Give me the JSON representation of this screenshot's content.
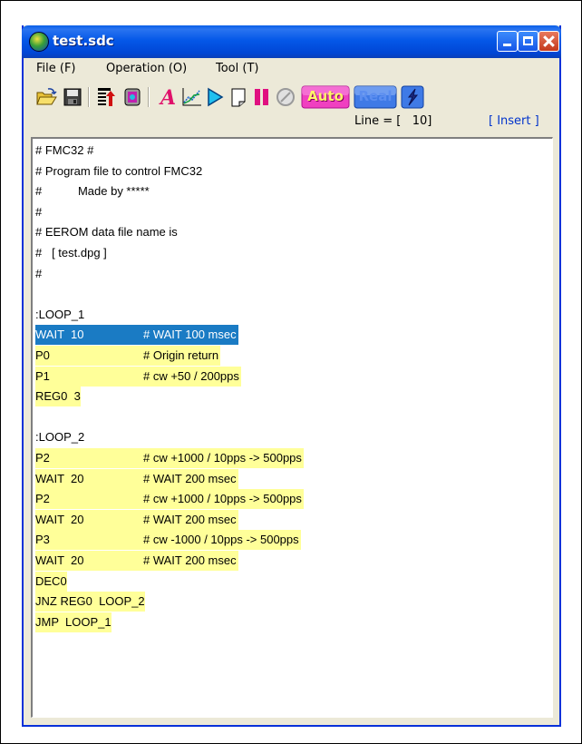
{
  "window": {
    "title": "test.sdc"
  },
  "menu": {
    "items": [
      {
        "label": "File (F)"
      },
      {
        "label": "Operation (O)"
      },
      {
        "label": "Tool (T)"
      }
    ]
  },
  "toolbar": {
    "buttons": [
      {
        "icon": "open-folder-icon"
      },
      {
        "icon": "save-disk-icon"
      },
      {
        "icon": "upload-icon"
      },
      {
        "icon": "database-icon"
      },
      {
        "icon": "font-a-icon"
      },
      {
        "icon": "graph-icon"
      },
      {
        "icon": "play-icon"
      },
      {
        "icon": "step-icon"
      },
      {
        "icon": "pause-icon"
      },
      {
        "icon": "stop-icon"
      },
      {
        "label": "Auto"
      },
      {
        "label": "Real"
      },
      {
        "icon": "lightning-icon"
      }
    ],
    "auto_label": "Auto",
    "real_label": "Real"
  },
  "status": {
    "line": "Line = [   10]",
    "mode": "[ Insert ]"
  },
  "editor": {
    "lines": [
      {
        "text": "# FMC32 #",
        "comment": "",
        "style": "plain"
      },
      {
        "text": "# Program file to control FMC32",
        "comment": "",
        "style": "plain"
      },
      {
        "text": "#           Made by *****",
        "comment": "",
        "style": "plain"
      },
      {
        "text": "#",
        "comment": "",
        "style": "plain"
      },
      {
        "text": "# EEROM data file name is",
        "comment": "",
        "style": "plain"
      },
      {
        "text": "#   [ test.dpg ]",
        "comment": "",
        "style": "plain"
      },
      {
        "text": "#",
        "comment": "",
        "style": "plain"
      },
      {
        "text": "",
        "comment": "",
        "style": "plain"
      },
      {
        "text": ":LOOP_1",
        "comment": "",
        "style": "plain"
      },
      {
        "text": "WAIT  10",
        "comment": "# WAIT 100 msec",
        "style": "selected"
      },
      {
        "text": "P0",
        "comment": "# Origin return",
        "style": "highlight"
      },
      {
        "text": "P1",
        "comment": "# cw +50 / 200pps",
        "style": "highlight"
      },
      {
        "text": "REG0  3",
        "comment": "",
        "style": "highlight"
      },
      {
        "text": "",
        "comment": "",
        "style": "plain"
      },
      {
        "text": ":LOOP_2",
        "comment": "",
        "style": "plain"
      },
      {
        "text": "P2",
        "comment": "# cw +1000 / 10pps -> 500pps",
        "style": "highlight"
      },
      {
        "text": "WAIT  20",
        "comment": "# WAIT 200 msec",
        "style": "highlight"
      },
      {
        "text": "P2",
        "comment": "# cw +1000 / 10pps -> 500pps",
        "style": "highlight"
      },
      {
        "text": "WAIT  20",
        "comment": "# WAIT 200 msec",
        "style": "highlight"
      },
      {
        "text": "P3",
        "comment": "# cw -1000 / 10pps -> 500pps",
        "style": "highlight"
      },
      {
        "text": "WAIT  20",
        "comment": "# WAIT 200 msec",
        "style": "highlight"
      },
      {
        "text": "DEC0",
        "comment": "",
        "style": "highlight"
      },
      {
        "text": "JNZ REG0  LOOP_2",
        "comment": "",
        "style": "highlight"
      },
      {
        "text": "JMP  LOOP_1",
        "comment": "",
        "style": "highlight"
      }
    ]
  },
  "colors": {
    "titlebar": "#0558e8",
    "highlight": "#ffff99",
    "selection": "#1a7bc4",
    "status_mode": "#0033cc"
  }
}
